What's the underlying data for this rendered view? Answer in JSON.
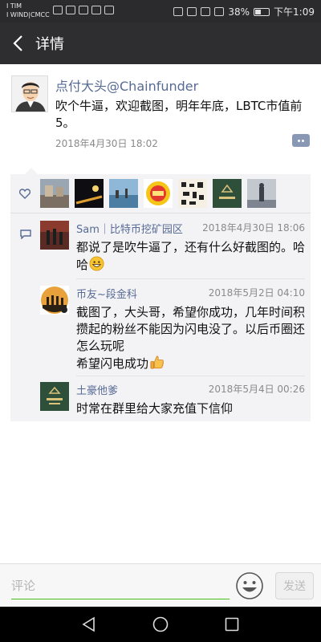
{
  "status_bar": {
    "carrier_line1": "I TIM",
    "carrier_line2": "I WIND|CMCC",
    "battery": "38%",
    "time": "下午1:09"
  },
  "title_bar": {
    "title": "详情"
  },
  "post": {
    "author": "点付大头@Chainfunder",
    "text": "吹个牛逼，欢迎截图，明年年底，LBTC市值前5。",
    "time": "2018年4月30日 18:02"
  },
  "likes": [
    "avatar-1",
    "avatar-2",
    "avatar-3",
    "avatar-4",
    "avatar-5",
    "avatar-6",
    "avatar-7"
  ],
  "comments": [
    {
      "name": "Sam｜比特币挖矿园区",
      "time": "2018年4月30日 18:06",
      "text": "都说了是吹牛逼了，还有什么好截图的。哈哈",
      "emoji": "grin-emoji"
    },
    {
      "name": "币友~段金科",
      "time": "2018年5月2日 04:10",
      "text": "截图了，大头哥，希望你成功，几年时间积攒起的粉丝不能因为闪电没了。以后币圈还怎么玩呢",
      "text2": "希望闪电成功",
      "emoji": "thumbs-up-emoji"
    },
    {
      "name": "土豪他爹",
      "time": "2018年5月4日 00:26",
      "text": "时常在群里给大家充值下信仰"
    }
  ],
  "input_bar": {
    "placeholder": "评论",
    "send_label": "发送"
  },
  "colors": {
    "link": "#576b95",
    "accent_green": "#45c01a"
  }
}
